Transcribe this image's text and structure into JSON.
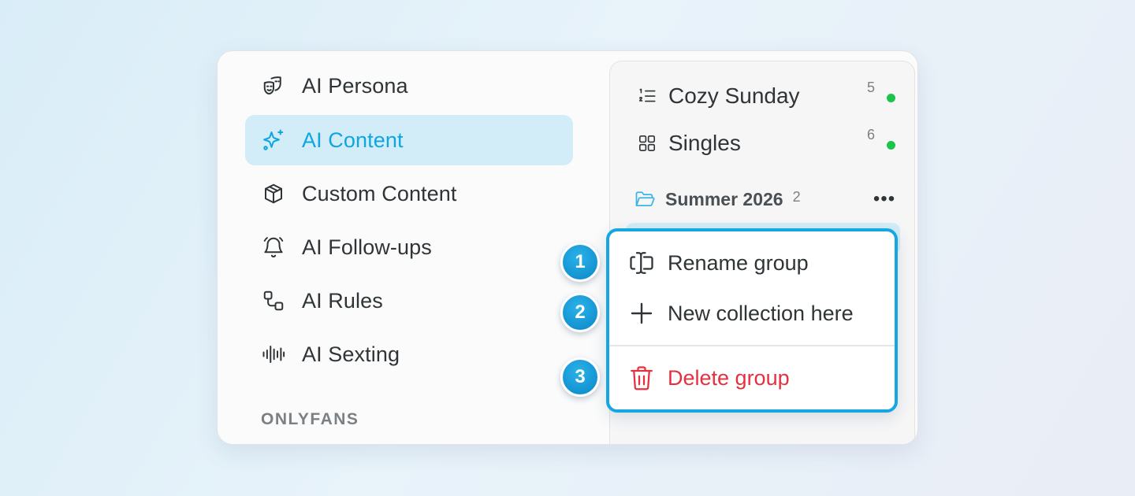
{
  "nav": {
    "items": [
      {
        "label": "AI Persona",
        "icon": "theater-masks-icon",
        "active": false
      },
      {
        "label": "AI Content",
        "icon": "sparkles-icon",
        "active": true
      },
      {
        "label": "Custom Content",
        "icon": "box-icon",
        "active": false
      },
      {
        "label": "AI Follow-ups",
        "icon": "bell-icon",
        "active": false
      },
      {
        "label": "AI Rules",
        "icon": "workflow-icon",
        "active": false
      },
      {
        "label": "AI Sexting",
        "icon": "audio-waveform-icon",
        "active": false
      }
    ],
    "section_heading": "ONLYFANS"
  },
  "collections": [
    {
      "label": "Cozy Sunday",
      "icon": "numbered-list-icon",
      "count": "5",
      "status_color": "#1bc44a"
    },
    {
      "label": "Singles",
      "icon": "grid-icon",
      "count": "6",
      "status_color": "#1bc44a"
    }
  ],
  "group": {
    "label": "Summer 2026",
    "count": "2",
    "icon": "folder-open-icon",
    "more_label": "•••"
  },
  "context_menu": {
    "items": [
      {
        "label": "Rename group",
        "icon": "text-cursor-input-icon",
        "step": "1"
      },
      {
        "label": "New collection here",
        "icon": "plus-icon",
        "step": "2"
      },
      {
        "label": "Delete group",
        "icon": "trash-icon",
        "step": "3",
        "danger": true
      }
    ]
  },
  "colors": {
    "accent": "#0ea5e0",
    "active_bg": "#d3edf8",
    "danger": "#e5303f",
    "status_green": "#1bc44a",
    "step_badge": "#0b86c6"
  }
}
